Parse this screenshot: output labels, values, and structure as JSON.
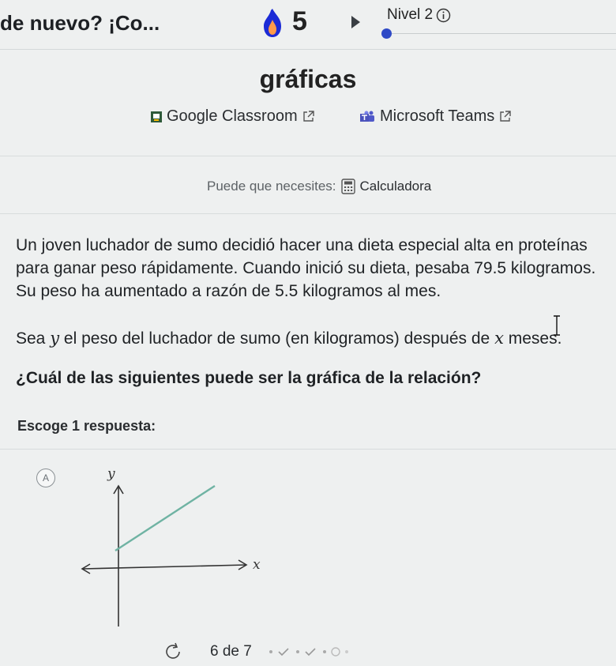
{
  "header": {
    "title": "de nuevo? ¡Co...",
    "streak_count": "5",
    "level_label": "Nivel 2"
  },
  "topic": "gráficas",
  "share": {
    "google_classroom": "Google Classroom",
    "microsoft_teams": "Microsoft Teams"
  },
  "tools": {
    "prefix": "Puede que necesites:",
    "calculator": "Calculadora"
  },
  "problem": {
    "paragraph1": "Un joven luchador de sumo decidió hacer una dieta especial alta en proteínas para ganar peso rápidamente. Cuando inició su dieta, pesaba 79.5 kilogramos. Su peso ha aumentado a razón de 5.5 kilogramos al mes.",
    "p2_a": "Sea ",
    "p2_var_y": "y",
    "p2_b": " el peso del luchador de sumo (en kilogramos) después de ",
    "p2_var_x": "x",
    "p2_c": " meses.",
    "question": "¿Cuál de las siguientes puede ser la gráfica de la relación?",
    "choose_prompt": "Escoge 1 respuesta:"
  },
  "choices": [
    {
      "letter": "A",
      "y_label": "y",
      "x_label": "x"
    }
  ],
  "footer": {
    "progress_text": "6 de 7"
  },
  "colors": {
    "accent": "#2f4ac6",
    "graph_line": "#6fb3a3",
    "streak": "#1c2bd6"
  },
  "icons": [
    "streak-flame-icon",
    "play-icon",
    "info-icon",
    "external-link-icon",
    "google-classroom-icon",
    "microsoft-teams-icon",
    "calculator-icon",
    "refresh-icon"
  ]
}
